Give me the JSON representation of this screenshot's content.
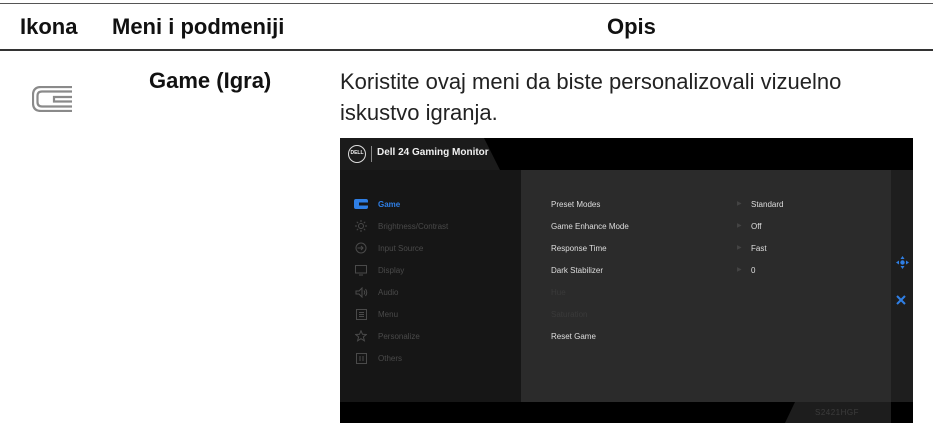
{
  "header": {
    "col_icon": "Ikona",
    "col_menu": "Meni i podmeniji",
    "col_desc": "Opis"
  },
  "row": {
    "icon": "game-controller-icon",
    "menu_name": "Game (Igra)",
    "description": "Koristite ovaj meni da biste personalizovali vizuelno iskustvo igranja."
  },
  "osd": {
    "title": "Dell 24 Gaming Monitor",
    "logo_text": "DELL",
    "model": "S2421HGF",
    "accent_color": "#2f7fe5",
    "sidebar": [
      {
        "label": "Game",
        "icon": "game-icon",
        "active": true
      },
      {
        "label": "Brightness/Contrast",
        "icon": "brightness-icon",
        "active": false
      },
      {
        "label": "Input Source",
        "icon": "input-source-icon",
        "active": false
      },
      {
        "label": "Display",
        "icon": "display-icon",
        "active": false
      },
      {
        "label": "Audio",
        "icon": "audio-icon",
        "active": false
      },
      {
        "label": "Menu",
        "icon": "menu-icon",
        "active": false
      },
      {
        "label": "Personalize",
        "icon": "star-icon",
        "active": false
      },
      {
        "label": "Others",
        "icon": "others-icon",
        "active": false
      }
    ],
    "settings": [
      {
        "label": "Preset Modes",
        "value": "Standard",
        "enabled": true
      },
      {
        "label": "Game Enhance Mode",
        "value": "Off",
        "enabled": true
      },
      {
        "label": "Response Time",
        "value": "Fast",
        "enabled": true
      },
      {
        "label": "Dark Stabilizer",
        "value": "0",
        "enabled": true
      },
      {
        "label": "Hue",
        "value": "",
        "enabled": false
      },
      {
        "label": "Saturation",
        "value": "",
        "enabled": false
      },
      {
        "label": "Reset Game",
        "value": "",
        "enabled": true
      }
    ],
    "nav": {
      "move_icon": "navigate-icon",
      "close_icon": "close-icon"
    }
  }
}
